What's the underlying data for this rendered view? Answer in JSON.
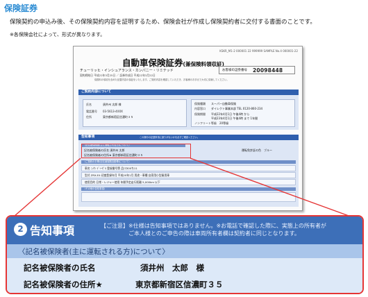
{
  "page": {
    "title": "保険証券",
    "intro": "保険契約の申込み後、その保険契約内容を証明するため、保険会社が作成し保険契約者に交付する書面のことです。",
    "note": "※各保険会社によって、形式が異なります。"
  },
  "certificate": {
    "code": "KSKR_M1-2 000001 22 999999 SAMPLE No.4 000001-22",
    "title": "自動車保険証券",
    "title_sub": "(兼保険料領収証)",
    "company": "チューリッヒ・インシュアランス・カンパニー・リミテッド",
    "date_line": "契約締結日 平成22年3月25日  ／  証券作成日 平成22年3月22日",
    "policy_no_label": "お客様の証券番号",
    "policy_no": "20098448",
    "fine_print": "保険料の領収を含めた記載内容の保証をいたします。ご契約内容を確認していただき、お客様のお手元で大切に保管してください。",
    "section1_title": "ご契約内容について",
    "name_label": "氏名",
    "name_value": "須井州  太郎  様",
    "phone_label": "電話番号",
    "phone_value": "03-5613-4XXX",
    "address_label": "住所",
    "address_value": "東京都新宿区信濃町３５",
    "product_label": "保険種類",
    "product_value": "スーパー自動車保険",
    "desk_label": "内容窓口",
    "desk_value": "ダイレクト事業本部  TEL 0120-860-234",
    "period_label": "保険期間",
    "period_value": "平成22年4月1日 午後4時 から",
    "period_value2": "平成23年4月1日 午後4時 まで 1年間",
    "grade_label": "ノンフリート等級",
    "grade_value": "20等級",
    "section2_title": "告知事項",
    "section2_note": "この欄中の記載事項に誤りがないかを必ずご確認ください。",
    "insured_bar": "〈記名被保険者(主に運転される方)について〉",
    "insured_name": "記名被保険者の氏名       須井州 太郎",
    "insured_addr": "記名被保険者の住所★  東京都新宿区信濃町３５",
    "license_label": "運転免許証の色",
    "license_value": "ブルー",
    "vehicle_bar": "〈ご契約のお車(記名被保険自動車)について〉",
    "vehicle_row1": "車名  ﾆｯｻﾝ ﾃﾞｨｰｾﾞﾙ    登録番号等  品川300ち11",
    "vehicle_row2": "型式  ZRX-E4    初度登録年月  平成20年1月    用途・車種  自家用小型乗用車",
    "vehicle_row3": "使用目的  日常・レジャー使用    年間予定走行距離  5,000km 以下",
    "other_bar": "〈その他の告知事項〉"
  },
  "zoom": {
    "number": "2",
    "title": "告知事項",
    "caution_line1": "【ご注意】※仕様は告知事項ではありません。※お電話で確認した際に、実態上の所有者が",
    "caution_line2": "ご本人様とのご申告の際は車両所有者欄は契約者に同じとなります。",
    "subheading": "〈記名被保険者(主に運転される方)について〉",
    "name_label": "記名被保険者の氏名",
    "name_value": "須井州　太郎　様",
    "address_label": "記名被保険者の住所★",
    "address_value": "東京都新宿区信濃町３５"
  },
  "colors": {
    "title_blue": "#2a8bd3",
    "header_blue": "#3d6fb8",
    "band_blue": "#a9c5ea",
    "body_blue": "#dde9f8",
    "highlight_red": "#e53535"
  }
}
